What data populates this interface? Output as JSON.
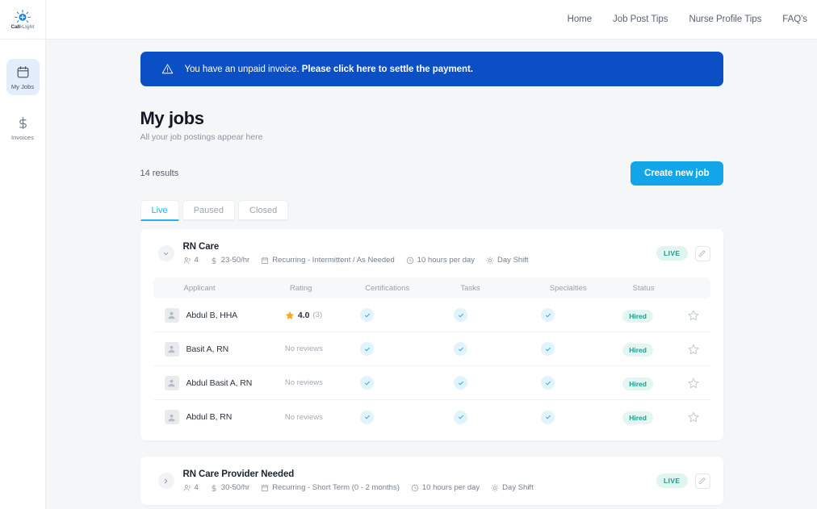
{
  "brand": {
    "name_bold": "Call-",
    "name_light": "Light",
    "logo_icon": "call-light-bulb-icon"
  },
  "sidebar": {
    "items": [
      {
        "label": "My Jobs",
        "icon": "calendar-icon",
        "active": true
      },
      {
        "label": "Invoices",
        "icon": "dollar-icon",
        "active": false
      }
    ]
  },
  "topnav": {
    "links": [
      {
        "label": "Home"
      },
      {
        "label": "Job Post Tips"
      },
      {
        "label": "Nurse Profile Tips"
      },
      {
        "label": "FAQ's"
      }
    ]
  },
  "banner": {
    "icon": "warning-triangle-icon",
    "text_plain": "You have an unpaid invoice. ",
    "text_bold": "Please click here to settle the payment.",
    "background": "#0b4fc4"
  },
  "header": {
    "title": "My jobs",
    "subtitle": "All your job postings appear here",
    "results": "14 results",
    "create_button": "Create new job",
    "create_button_color": "#12a5e8"
  },
  "tabs": [
    {
      "label": "Live",
      "active": true
    },
    {
      "label": "Paused",
      "active": false
    },
    {
      "label": "Closed",
      "active": false
    }
  ],
  "table_headers": [
    "Applicant",
    "Rating",
    "Certifications",
    "Tasks",
    "Specialties",
    "Status"
  ],
  "jobs": [
    {
      "title": "RN Care",
      "expanded": true,
      "toggle_icon": "chevron-down-icon",
      "status_badge": "LIVE",
      "status_color": "#1a9e8e",
      "edit_icon": "pencil-icon",
      "meta": [
        {
          "icon": "people-icon",
          "text": "4"
        },
        {
          "icon": "dollar-icon",
          "text": "23-50/hr"
        },
        {
          "icon": "calendar-icon",
          "text": "Recurring - Intermittent / As Needed"
        },
        {
          "icon": "clock-icon",
          "text": "10 hours per day"
        },
        {
          "icon": "sun-icon",
          "text": "Day Shift"
        }
      ],
      "applicants": [
        {
          "name": "Abdul B, HHA",
          "rating": "4.0",
          "rating_count": "(3)",
          "has_rating": true,
          "certifications": true,
          "tasks": true,
          "specialties": true,
          "status": "Hired",
          "favorite": false
        },
        {
          "name": "Basit A, RN",
          "rating": "No reviews",
          "rating_count": "",
          "has_rating": false,
          "certifications": true,
          "tasks": true,
          "specialties": true,
          "status": "Hired",
          "favorite": false
        },
        {
          "name": "Abdul Basit A, RN",
          "rating": "No reviews",
          "rating_count": "",
          "has_rating": false,
          "certifications": true,
          "tasks": true,
          "specialties": true,
          "status": "Hired",
          "favorite": false
        },
        {
          "name": "Abdul B, RN",
          "rating": "No reviews",
          "rating_count": "",
          "has_rating": false,
          "certifications": true,
          "tasks": true,
          "specialties": true,
          "status": "Hired",
          "favorite": false
        }
      ]
    },
    {
      "title": "RN Care Provider Needed",
      "expanded": false,
      "toggle_icon": "chevron-right-icon",
      "status_badge": "LIVE",
      "status_color": "#1a9e8e",
      "edit_icon": "pencil-icon",
      "meta": [
        {
          "icon": "people-icon",
          "text": "4"
        },
        {
          "icon": "dollar-icon",
          "text": "30-50/hr"
        },
        {
          "icon": "calendar-icon",
          "text": "Recurring - Short Term (0 - 2 months)"
        },
        {
          "icon": "clock-icon",
          "text": "10 hours per day"
        },
        {
          "icon": "sun-icon",
          "text": "Day Shift"
        }
      ],
      "applicants": []
    }
  ]
}
